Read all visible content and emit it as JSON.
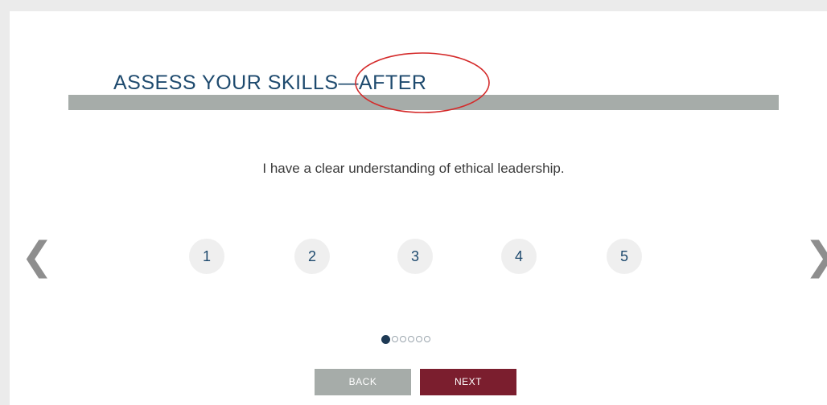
{
  "title": "ASSESS YOUR SKILLS—AFTER",
  "question": "I have a clear understanding of ethical leadership.",
  "ratings": [
    "1",
    "2",
    "3",
    "4",
    "5"
  ],
  "nav": {
    "prev_icon": "chevron-left-icon",
    "next_icon": "chevron-right-icon",
    "prev_glyph": "❮",
    "next_glyph": "❯"
  },
  "pagination": {
    "total": 6,
    "current": 1
  },
  "buttons": {
    "back_label": "BACK",
    "next_label": "NEXT"
  },
  "colors": {
    "title": "#1e4a6e",
    "title_bar": "#a6aca9",
    "annotation": "#d42a2a",
    "next_button": "#7b1e2e",
    "back_button": "#a6aca9"
  }
}
